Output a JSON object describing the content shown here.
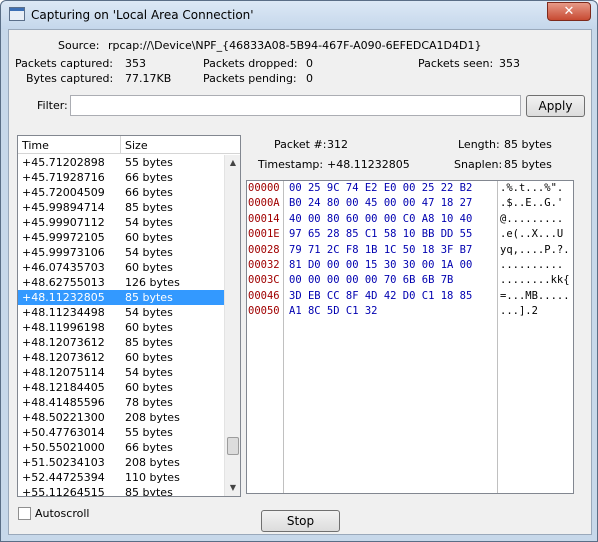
{
  "window": {
    "title": "Capturing on 'Local Area Connection'",
    "close_glyph": "✕",
    "icon": "app-window-icon"
  },
  "stats": {
    "source_label": "Source:",
    "source_value": "rpcap://\\Device\\NPF_{46833A08-5B94-467F-A090-6EFEDCA1D4D1}",
    "packets_captured_label": "Packets captured:",
    "packets_captured_value": "353",
    "bytes_captured_label": "Bytes captured:",
    "bytes_captured_value": "77.17KB",
    "packets_dropped_label": "Packets dropped:",
    "packets_dropped_value": "0",
    "packets_pending_label": "Packets pending:",
    "packets_pending_value": "0",
    "packets_seen_label": "Packets seen:",
    "packets_seen_value": "353"
  },
  "filter": {
    "label": "Filter:",
    "value": "",
    "apply_label": "Apply"
  },
  "list": {
    "col_time": "Time",
    "col_size": "Size",
    "rows": [
      {
        "time": "+45.71202898",
        "size": "55 bytes"
      },
      {
        "time": "+45.71928716",
        "size": "66 bytes"
      },
      {
        "time": "+45.72004509",
        "size": "66 bytes"
      },
      {
        "time": "+45.99894714",
        "size": "85 bytes"
      },
      {
        "time": "+45.99907112",
        "size": "54 bytes"
      },
      {
        "time": "+45.99972105",
        "size": "60 bytes"
      },
      {
        "time": "+45.99973106",
        "size": "54 bytes"
      },
      {
        "time": "+46.07435703",
        "size": "60 bytes"
      },
      {
        "time": "+48.62755013",
        "size": "126 bytes"
      },
      {
        "time": "+48.11232805",
        "size": "85 bytes"
      },
      {
        "time": "+48.11234498",
        "size": "54 bytes"
      },
      {
        "time": "+48.11996198",
        "size": "60 bytes"
      },
      {
        "time": "+48.12073612",
        "size": "85 bytes"
      },
      {
        "time": "+48.12073612",
        "size": "60 bytes"
      },
      {
        "time": "+48.12075114",
        "size": "54 bytes"
      },
      {
        "time": "+48.12184405",
        "size": "60 bytes"
      },
      {
        "time": "+48.41485596",
        "size": "78 bytes"
      },
      {
        "time": "+48.50221300",
        "size": "208 bytes"
      },
      {
        "time": "+50.47763014",
        "size": "55 bytes"
      },
      {
        "time": "+50.55021000",
        "size": "66 bytes"
      },
      {
        "time": "+51.50234103",
        "size": "208 bytes"
      },
      {
        "time": "+52.44725394",
        "size": "110 bytes"
      },
      {
        "time": "+55.11264515",
        "size": "85 bytes"
      }
    ],
    "selected_index": 9
  },
  "details": {
    "packet_label": "Packet #:",
    "packet_value": "312",
    "length_label": "Length:",
    "length_value": "85 bytes",
    "timestamp_label": "Timestamp:",
    "timestamp_value": "+48.11232805",
    "snaplen_label": "Snaplen:",
    "snaplen_value": "85 bytes"
  },
  "hex": {
    "offsets": [
      "00000",
      "0000A",
      "00014",
      "0001E",
      "00028",
      "00032",
      "0003C",
      "00046",
      "00050"
    ],
    "bytes": [
      "00 25 9C 74 E2 E0 00 25 22 B2",
      "B0 24 80 00 45 00 00 47 18 27",
      "40 00 80 60 00 00 C0 A8 10 40",
      "97 65 28 85 C1 58 10 BB DD 55",
      "79 71 2C F8 1B 1C 50 18 3F B7",
      "81 D0 00 00 15 30 30 00 1A 00",
      "00 00 00 00 00 70 6B 6B 7B",
      "3D EB CC 8F 4D 42 D0 C1 18 85",
      "A1 8C 5D C1 32"
    ],
    "ascii": [
      ".%.t...%\".",
      ".$..E..G.'",
      "@.........",
      ".e(..X...U",
      "yq,....P.?.",
      "..........",
      "........kk{",
      "=...MB.....",
      "...].2"
    ]
  },
  "footer": {
    "autoscroll_label": "Autoscroll",
    "stop_label": "Stop"
  }
}
